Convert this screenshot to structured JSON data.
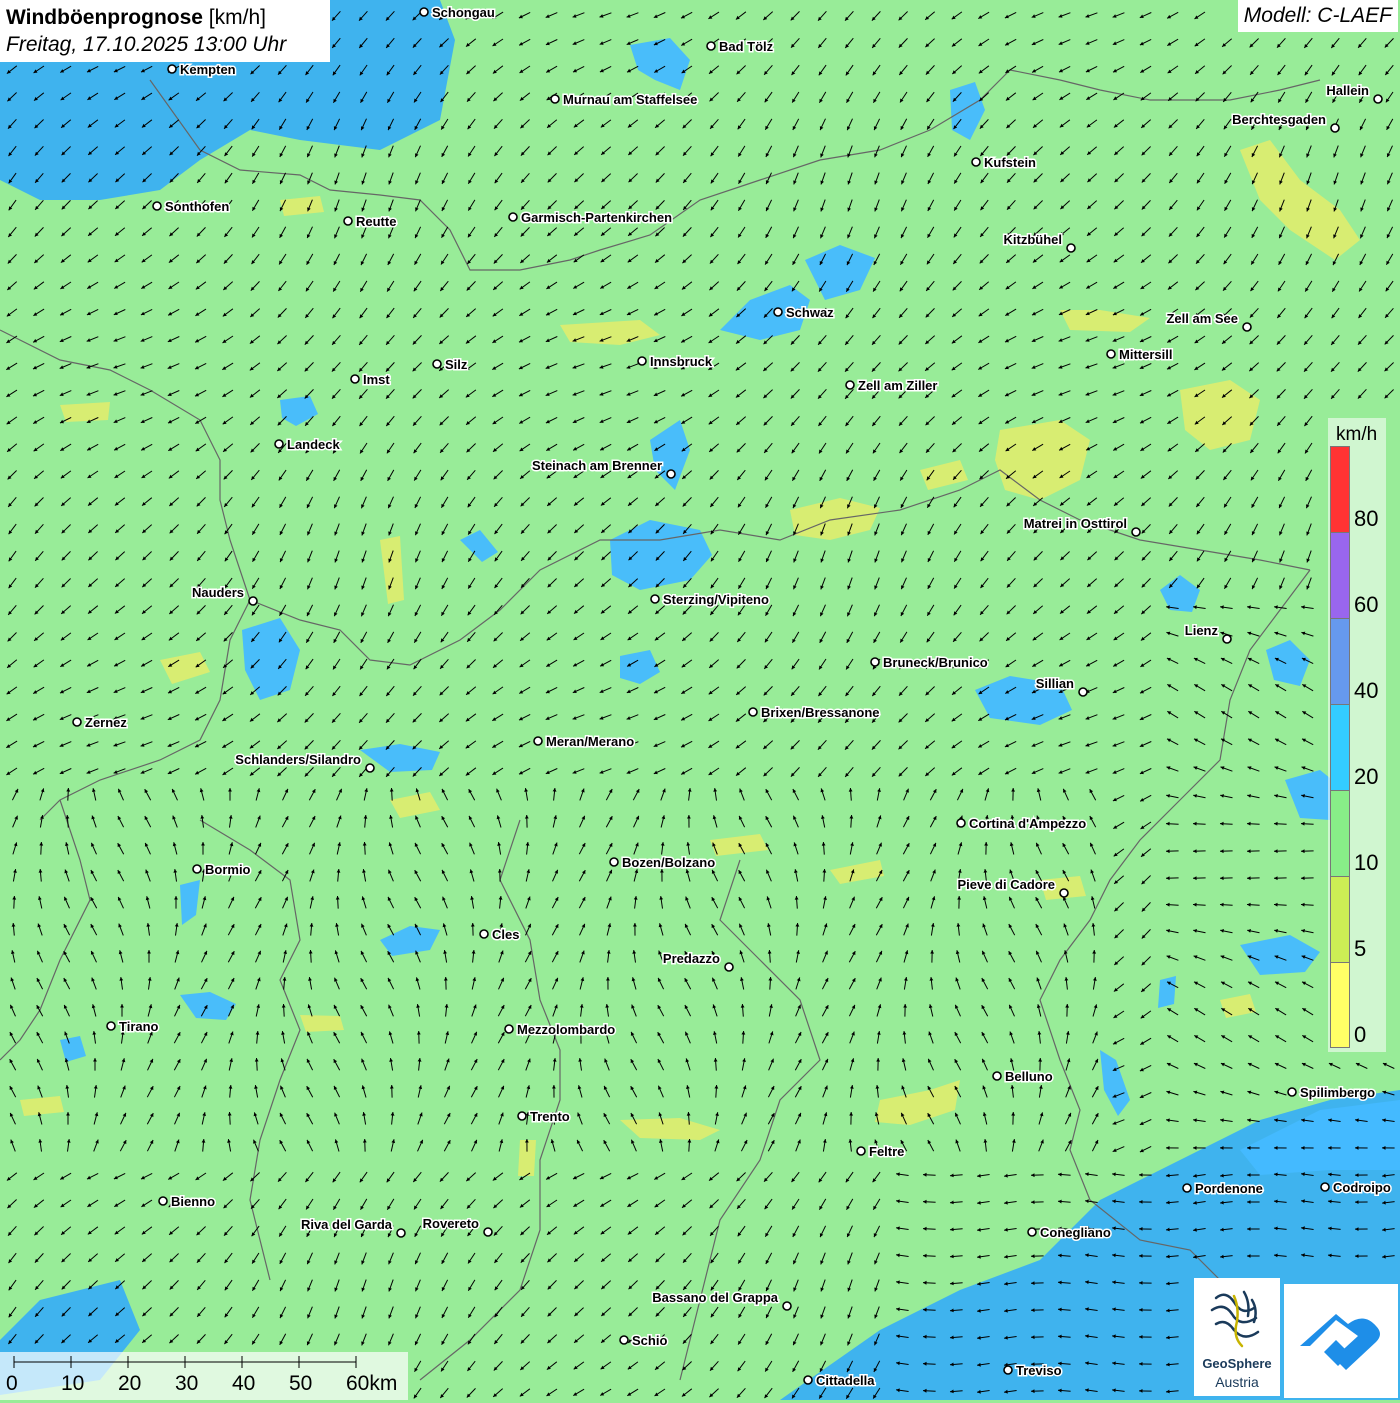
{
  "title": {
    "bold": "Windböenprognose",
    "unit": " [km/h]",
    "date": "Freitag, 17.10.2025 13:00 Uhr"
  },
  "model": "Modell: C-LAEF",
  "legend": {
    "unit": "km/h",
    "bins": [
      {
        "label": "80",
        "color": "#ff3333"
      },
      {
        "label": "60",
        "color": "#9966ee"
      },
      {
        "label": "40",
        "color": "#6699ee"
      },
      {
        "label": "20",
        "color": "#33ccff"
      },
      {
        "label": "10",
        "color": "#88ee88"
      },
      {
        "label": "5",
        "color": "#ccee55"
      },
      {
        "label": "0",
        "color": "#ffff66"
      }
    ]
  },
  "scale": {
    "labels": [
      "0",
      "10",
      "20",
      "30",
      "40",
      "50",
      "60km"
    ]
  },
  "colors": {
    "base": "#98ec98",
    "calm": "#eeee66",
    "breezy": "#44bbff",
    "lake": "#3ab0f2",
    "border": "#666666"
  },
  "logos": {
    "geosphere_line1": "GeoSphere",
    "geosphere_line2": "Austria"
  },
  "wind": {
    "arrow_field": "wind-direction-arrows"
  },
  "cities": [
    {
      "name": "Schongau",
      "side": "r"
    },
    {
      "name": "Kempten",
      "side": "r"
    },
    {
      "name": "Bad Tölz",
      "side": "r"
    },
    {
      "name": "Murnau am Staffelsee",
      "side": "r"
    },
    {
      "name": "Hallein",
      "side": "l"
    },
    {
      "name": "Berchtesgaden",
      "side": "l"
    },
    {
      "name": "Kufstein",
      "side": "r"
    },
    {
      "name": "Sonthofen",
      "side": "r"
    },
    {
      "name": "Reutte",
      "side": "r"
    },
    {
      "name": "Garmisch-Partenkirchen",
      "side": "r"
    },
    {
      "name": "Kitzbühel",
      "side": "l"
    },
    {
      "name": "Schwaz",
      "side": "r"
    },
    {
      "name": "Zell am See",
      "side": "l"
    },
    {
      "name": "Innsbruck",
      "side": "r"
    },
    {
      "name": "Mittersill",
      "side": "r"
    },
    {
      "name": "Silz",
      "side": "r"
    },
    {
      "name": "Imst",
      "side": "r"
    },
    {
      "name": "Zell am Ziller",
      "side": "r"
    },
    {
      "name": "Landeck",
      "side": "r"
    },
    {
      "name": "Steinach am Brenner",
      "side": "l"
    },
    {
      "name": "Matrei in Osttirol",
      "side": "l"
    },
    {
      "name": "Nauders",
      "side": "l"
    },
    {
      "name": "Sterzing/Vipiteno",
      "side": "r"
    },
    {
      "name": "Lienz",
      "side": "l"
    },
    {
      "name": "Bruneck/Brunico",
      "side": "r"
    },
    {
      "name": "Sillian",
      "side": "l"
    },
    {
      "name": "Zernez",
      "side": "r"
    },
    {
      "name": "Brixen/Bressanone",
      "side": "r"
    },
    {
      "name": "Meran/Merano",
      "side": "r"
    },
    {
      "name": "Schlanders/Silandro",
      "side": "l"
    },
    {
      "name": "Cortina d'Ampezzo",
      "side": "r"
    },
    {
      "name": "Bormio",
      "side": "r"
    },
    {
      "name": "Bozen/Bolzano",
      "side": "r"
    },
    {
      "name": "Pieve di Cadore",
      "side": "l"
    },
    {
      "name": "Cles",
      "side": "r"
    },
    {
      "name": "Predazzo",
      "side": "l"
    },
    {
      "name": "Tirano",
      "side": "r"
    },
    {
      "name": "Mezzolombardo",
      "side": "r"
    },
    {
      "name": "Belluno",
      "side": "r"
    },
    {
      "name": "Spilimbergo",
      "side": "r"
    },
    {
      "name": "Trento",
      "side": "r"
    },
    {
      "name": "Feltre",
      "side": "r"
    },
    {
      "name": "Pordenone",
      "side": "r"
    },
    {
      "name": "Codroipo",
      "side": "r"
    },
    {
      "name": "Bienno",
      "side": "r"
    },
    {
      "name": "Riva del Garda",
      "side": "l"
    },
    {
      "name": "Rovereto",
      "side": "l"
    },
    {
      "name": "Conegliano",
      "side": "r"
    },
    {
      "name": "Bassano del Grappa",
      "side": "l"
    },
    {
      "name": "Schio",
      "side": "r"
    },
    {
      "name": "Treviso",
      "side": "r"
    },
    {
      "name": "Cittadella",
      "side": "r"
    }
  ]
}
